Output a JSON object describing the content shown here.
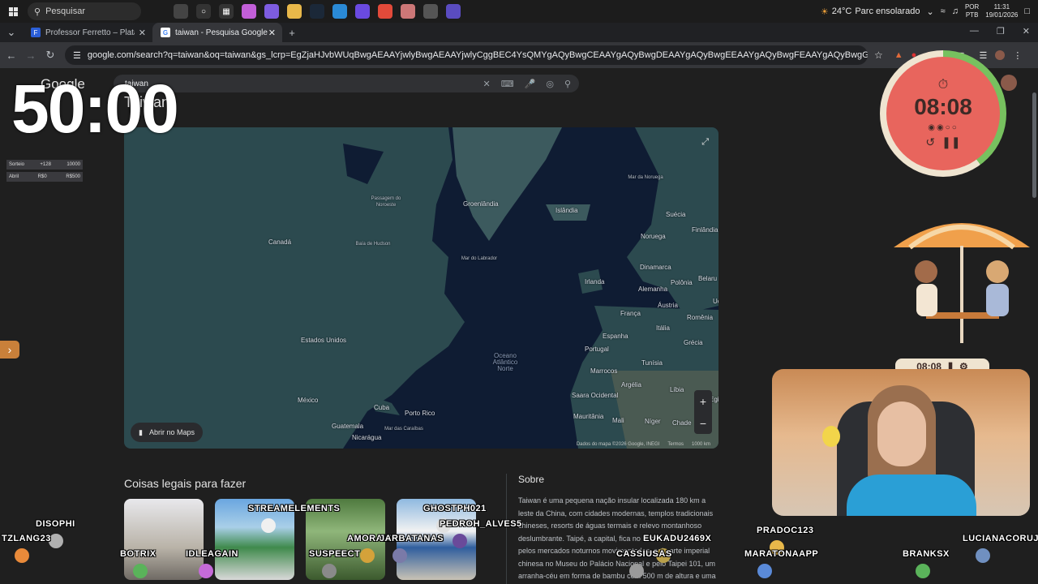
{
  "taskbar": {
    "search_placeholder": "Pesquisar",
    "weather_temp": "24°C",
    "weather_text": "Parc ensolarado",
    "lang_line1": "POR",
    "lang_line2": "PTB",
    "time": "11:31",
    "date": "19/01/2026"
  },
  "tabs": [
    {
      "label": "Professor Ferretto – Plataforma",
      "favicon": "F"
    },
    {
      "label": "taiwan - Pesquisa Google",
      "favicon": "G"
    }
  ],
  "address": {
    "url": "google.com/search?q=taiwan&oq=taiwan&gs_lcrp=EgZjaHJvbWUqBwgAEAAYjwlyBwgAEAAYjwlyCggBEC4YsQMYgAQyBwgCEAAYgAQyBwgDEAAYgAQyBwgEEAAYgAQyBwgFEAAYgAQyBwgGEAAYgAQyBwgHEAAYgAQyBwgIEA..."
  },
  "google": {
    "logo": "Google",
    "query": "taiwan",
    "entity_title": "Taiwan"
  },
  "overlay": {
    "big_timer": "50:00",
    "sorteio": [
      {
        "label": "Sorteio",
        "a": "+128",
        "b": "10000"
      },
      {
        "label": "Abril",
        "a": "R$0",
        "b": "R$500"
      }
    ],
    "pomodoro_time": "08:08",
    "mini_timer": "08:08"
  },
  "map": {
    "labels": [
      {
        "text": "Groenlândia",
        "cls": ""
      },
      {
        "text": "Islândia",
        "cls": ""
      },
      {
        "text": "Mar da Noruega",
        "cls": "sm"
      },
      {
        "text": "Suécia",
        "cls": ""
      },
      {
        "text": "Finlândia",
        "cls": ""
      },
      {
        "text": "Noruega",
        "cls": ""
      },
      {
        "text": "Passagem do Noroeste",
        "cls": "sm"
      },
      {
        "text": "Canadá",
        "cls": ""
      },
      {
        "text": "Baía de Hudson",
        "cls": "sm"
      },
      {
        "text": "Mar do Labrador",
        "cls": "sm"
      },
      {
        "text": "Dinamarca",
        "cls": ""
      },
      {
        "text": "Irlanda",
        "cls": ""
      },
      {
        "text": "Polônia",
        "cls": ""
      },
      {
        "text": "Alemanha",
        "cls": ""
      },
      {
        "text": "Belaru",
        "cls": ""
      },
      {
        "text": "França",
        "cls": ""
      },
      {
        "text": "Áustria",
        "cls": ""
      },
      {
        "text": "Ucr",
        "cls": ""
      },
      {
        "text": "Romênia",
        "cls": ""
      },
      {
        "text": "Itália",
        "cls": ""
      },
      {
        "text": "Estados Unidos",
        "cls": ""
      },
      {
        "text": "Espanha",
        "cls": ""
      },
      {
        "text": "Portugal",
        "cls": ""
      },
      {
        "text": "Grécia",
        "cls": ""
      },
      {
        "text": "Oceano Atlântico Norte",
        "cls": "ocean"
      },
      {
        "text": "Tunísia",
        "cls": ""
      },
      {
        "text": "Marrocos",
        "cls": ""
      },
      {
        "text": "Argélia",
        "cls": ""
      },
      {
        "text": "Líbia",
        "cls": ""
      },
      {
        "text": "Egit",
        "cls": ""
      },
      {
        "text": "México",
        "cls": ""
      },
      {
        "text": "Saara Ocidental",
        "cls": ""
      },
      {
        "text": "Cuba",
        "cls": ""
      },
      {
        "text": "Porto Rico",
        "cls": ""
      },
      {
        "text": "Mauritânia",
        "cls": ""
      },
      {
        "text": "Mali",
        "cls": ""
      },
      {
        "text": "Níger",
        "cls": ""
      },
      {
        "text": "Chade",
        "cls": ""
      },
      {
        "text": "Guatemala",
        "cls": ""
      },
      {
        "text": "Mar das Caraíbas",
        "cls": "sm"
      },
      {
        "text": "Nicarágua",
        "cls": ""
      }
    ],
    "open_maps": "Abrir no Maps",
    "footer_data": "Dados do mapa ©2026 Google, INEGI",
    "footer_terms": "Termos",
    "footer_scale": "1000 km"
  },
  "things": {
    "title": "Coisas legais para fazer"
  },
  "about": {
    "title": "Sobre",
    "text": "Taiwan é uma pequena nação insular localizada 180 km a leste da China, com cidades modernas, templos tradicionais chineses, resorts de águas termais e relevo montanhoso deslumbrante. Taipé, a capital, fica no norte, é conhecida pelos mercados noturnos movimentados, pela arte imperial chinesa no Museu do Palácio Nacional e pelo Taipei 101, um arranha-céu em forma de bambu com 500 m de altura e uma plataforma de"
  },
  "chat_names": [
    "DISOPHI",
    "TZLANG23",
    "BOTRIX",
    "IDLEAGAIN",
    "STREAMELEMENTS",
    "SUSPEECT",
    "AMORALIH",
    "JARBATANAS",
    "GHOSTPH021",
    "PEDROH_ALVES5",
    "EUKADU2469X",
    "CASSIUSAS",
    "PRADOC123",
    "MARATONAAPP",
    "BRANKSX",
    "LUCIANACORUJ"
  ],
  "colors": {
    "ocean": "#0f1c33",
    "land": "#2c4a4f",
    "pomodoro_red": "#e8655d",
    "progress_green": "#77c15f"
  },
  "icons": [
    "windows-icon",
    "search-icon",
    "mic-icon",
    "keyboard-icon",
    "lens-icon",
    "apps-grid-icon",
    "star-icon",
    "reload-icon",
    "back-icon",
    "forward-icon",
    "expand-icon",
    "map-icon"
  ]
}
